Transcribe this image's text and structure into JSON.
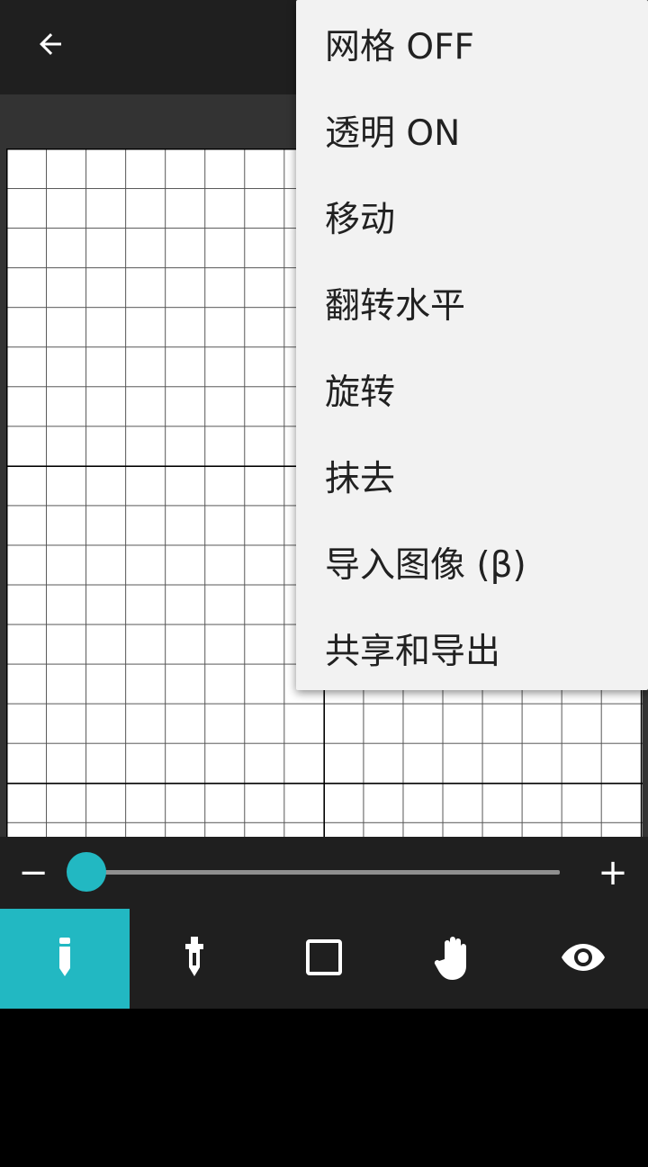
{
  "colors": {
    "accent": "#22b8c2",
    "toolbar_bg": "#1f1f1f",
    "canvas_bg": "#333333",
    "menu_bg": "#f2f2f2"
  },
  "topbar": {
    "back_icon": "arrow-left-icon"
  },
  "slider": {
    "minus_label": "−",
    "plus_label": "+",
    "value_fraction": 0.0
  },
  "tools": [
    {
      "icon": "pencil-icon",
      "active": true
    },
    {
      "icon": "eyedropper-icon",
      "active": false
    },
    {
      "icon": "square-icon",
      "active": false
    },
    {
      "icon": "hand-icon",
      "active": false
    },
    {
      "icon": "eye-icon",
      "active": false
    }
  ],
  "menu": {
    "items": [
      {
        "label": "网格 OFF"
      },
      {
        "label": "透明 ON"
      },
      {
        "label": "移动"
      },
      {
        "label": "翻转水平"
      },
      {
        "label": "旋转"
      },
      {
        "label": "抹去"
      },
      {
        "label": "导入图像 (β)"
      },
      {
        "label": "共享和导出"
      }
    ]
  }
}
